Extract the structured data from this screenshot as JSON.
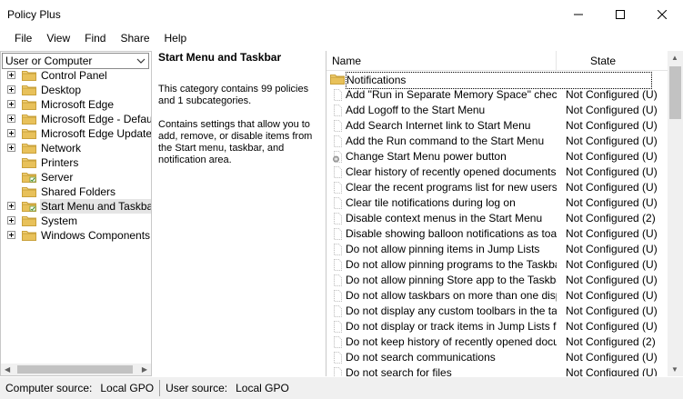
{
  "window": {
    "title": "Policy Plus"
  },
  "menu": [
    "File",
    "View",
    "Find",
    "Share",
    "Help"
  ],
  "left": {
    "scope_selector": "User or Computer",
    "tree": [
      {
        "label": "Control Panel",
        "expandable": true,
        "icon": "folder-icon"
      },
      {
        "label": "Desktop",
        "expandable": true,
        "icon": "folder-icon"
      },
      {
        "label": "Microsoft Edge",
        "expandable": true,
        "icon": "folder-icon"
      },
      {
        "label": "Microsoft Edge - Default S",
        "expandable": true,
        "icon": "folder-icon"
      },
      {
        "label": "Microsoft Edge Update",
        "expandable": true,
        "icon": "folder-icon"
      },
      {
        "label": "Network",
        "expandable": true,
        "icon": "folder-icon"
      },
      {
        "label": "Printers",
        "expandable": false,
        "icon": "folder-icon"
      },
      {
        "label": "Server",
        "expandable": false,
        "icon": "folder-policy-icon"
      },
      {
        "label": "Shared Folders",
        "expandable": false,
        "icon": "folder-icon"
      },
      {
        "label": "Start Menu and Taskbar",
        "expandable": true,
        "icon": "folder-policy-icon",
        "selected": true
      },
      {
        "label": "System",
        "expandable": true,
        "icon": "folder-icon"
      },
      {
        "label": "Windows Components",
        "expandable": true,
        "icon": "folder-icon"
      }
    ]
  },
  "middle": {
    "title": "Start Menu and Taskbar",
    "summary": "This category contains 99 policies and 1 subcategories.",
    "description": "Contains settings that allow you to add, remove, or disable items from the Start menu, taskbar, and notification area."
  },
  "list": {
    "col_name": "Name",
    "col_state": "State",
    "rows": [
      {
        "name": "Notifications",
        "state": "",
        "icon": "folder-icon"
      },
      {
        "name": "Add \"Run in Separate Memory Space\" check ...",
        "state": "Not Configured (U)",
        "icon": "policy-page-icon"
      },
      {
        "name": "Add Logoff to the Start Menu",
        "state": "Not Configured (U)",
        "icon": "policy-page-icon"
      },
      {
        "name": "Add Search Internet link to Start Menu",
        "state": "Not Configured (U)",
        "icon": "policy-page-icon"
      },
      {
        "name": "Add the Run command to the Start Menu",
        "state": "Not Configured (U)",
        "icon": "policy-page-icon"
      },
      {
        "name": "Change Start Menu power button",
        "state": "Not Configured (U)",
        "icon": "policy-gear-icon"
      },
      {
        "name": "Clear history of recently opened documents on ...",
        "state": "Not Configured (U)",
        "icon": "policy-page-icon"
      },
      {
        "name": "Clear the recent programs list for new users",
        "state": "Not Configured (U)",
        "icon": "policy-page-icon"
      },
      {
        "name": "Clear tile notifications during log on",
        "state": "Not Configured (U)",
        "icon": "policy-page-icon"
      },
      {
        "name": "Disable context menus in the Start Menu",
        "state": "Not Configured (2)",
        "icon": "policy-page-icon"
      },
      {
        "name": "Disable showing balloon notifications as toasts.",
        "state": "Not Configured (U)",
        "icon": "policy-page-icon"
      },
      {
        "name": "Do not allow pinning items in Jump Lists",
        "state": "Not Configured (U)",
        "icon": "policy-page-icon"
      },
      {
        "name": "Do not allow pinning programs to the Taskbar",
        "state": "Not Configured (U)",
        "icon": "policy-page-icon"
      },
      {
        "name": "Do not allow pinning Store app to the Taskbar",
        "state": "Not Configured (U)",
        "icon": "policy-page-icon"
      },
      {
        "name": "Do not allow taskbars on more than one display",
        "state": "Not Configured (U)",
        "icon": "policy-page-icon"
      },
      {
        "name": "Do not display any custom toolbars in the task...",
        "state": "Not Configured (U)",
        "icon": "policy-page-icon"
      },
      {
        "name": "Do not display or track items in Jump Lists from...",
        "state": "Not Configured (U)",
        "icon": "policy-page-icon"
      },
      {
        "name": "Do not keep history of recently opened docum...",
        "state": "Not Configured (2)",
        "icon": "policy-page-icon"
      },
      {
        "name": "Do not search communications",
        "state": "Not Configured (U)",
        "icon": "policy-page-icon"
      },
      {
        "name": "Do not search for files",
        "state": "Not Configured (U)",
        "icon": "policy-page-icon"
      }
    ]
  },
  "status": {
    "computer_label": "Computer source:",
    "computer_value": "Local GPO",
    "user_label": "User source:",
    "user_value": "Local GPO"
  },
  "colors": {
    "folder": "#e8c15a",
    "selection": "#e5e5e5",
    "statusbar": "#f0f0f0"
  }
}
